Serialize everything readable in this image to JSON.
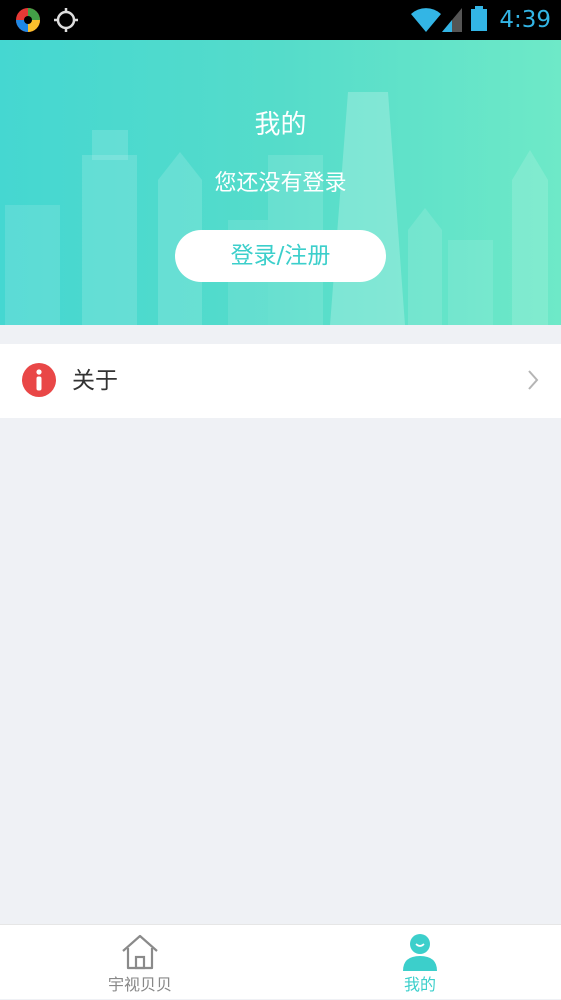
{
  "status_bar": {
    "time": "4:39",
    "icons": [
      "app-color-wheel-icon",
      "gps-crosshair-icon",
      "wifi-icon",
      "cellular-signal-icon",
      "battery-icon"
    ],
    "time_color": "#33b5e5"
  },
  "header": {
    "title": "我的",
    "subtitle": "您还没有登录",
    "login_button_label": "登录/注册",
    "gradient_start": "#45d7d1",
    "gradient_end": "#6ee9c8"
  },
  "menu": {
    "items": [
      {
        "label": "关于",
        "icon": "info-icon",
        "icon_color": "#e94747"
      }
    ]
  },
  "tab_bar": {
    "tabs": [
      {
        "label": "宇视贝贝",
        "icon": "home-icon",
        "selected": false
      },
      {
        "label": "我的",
        "icon": "person-icon",
        "selected": true
      }
    ],
    "accent_color": "#3ccfcb"
  }
}
